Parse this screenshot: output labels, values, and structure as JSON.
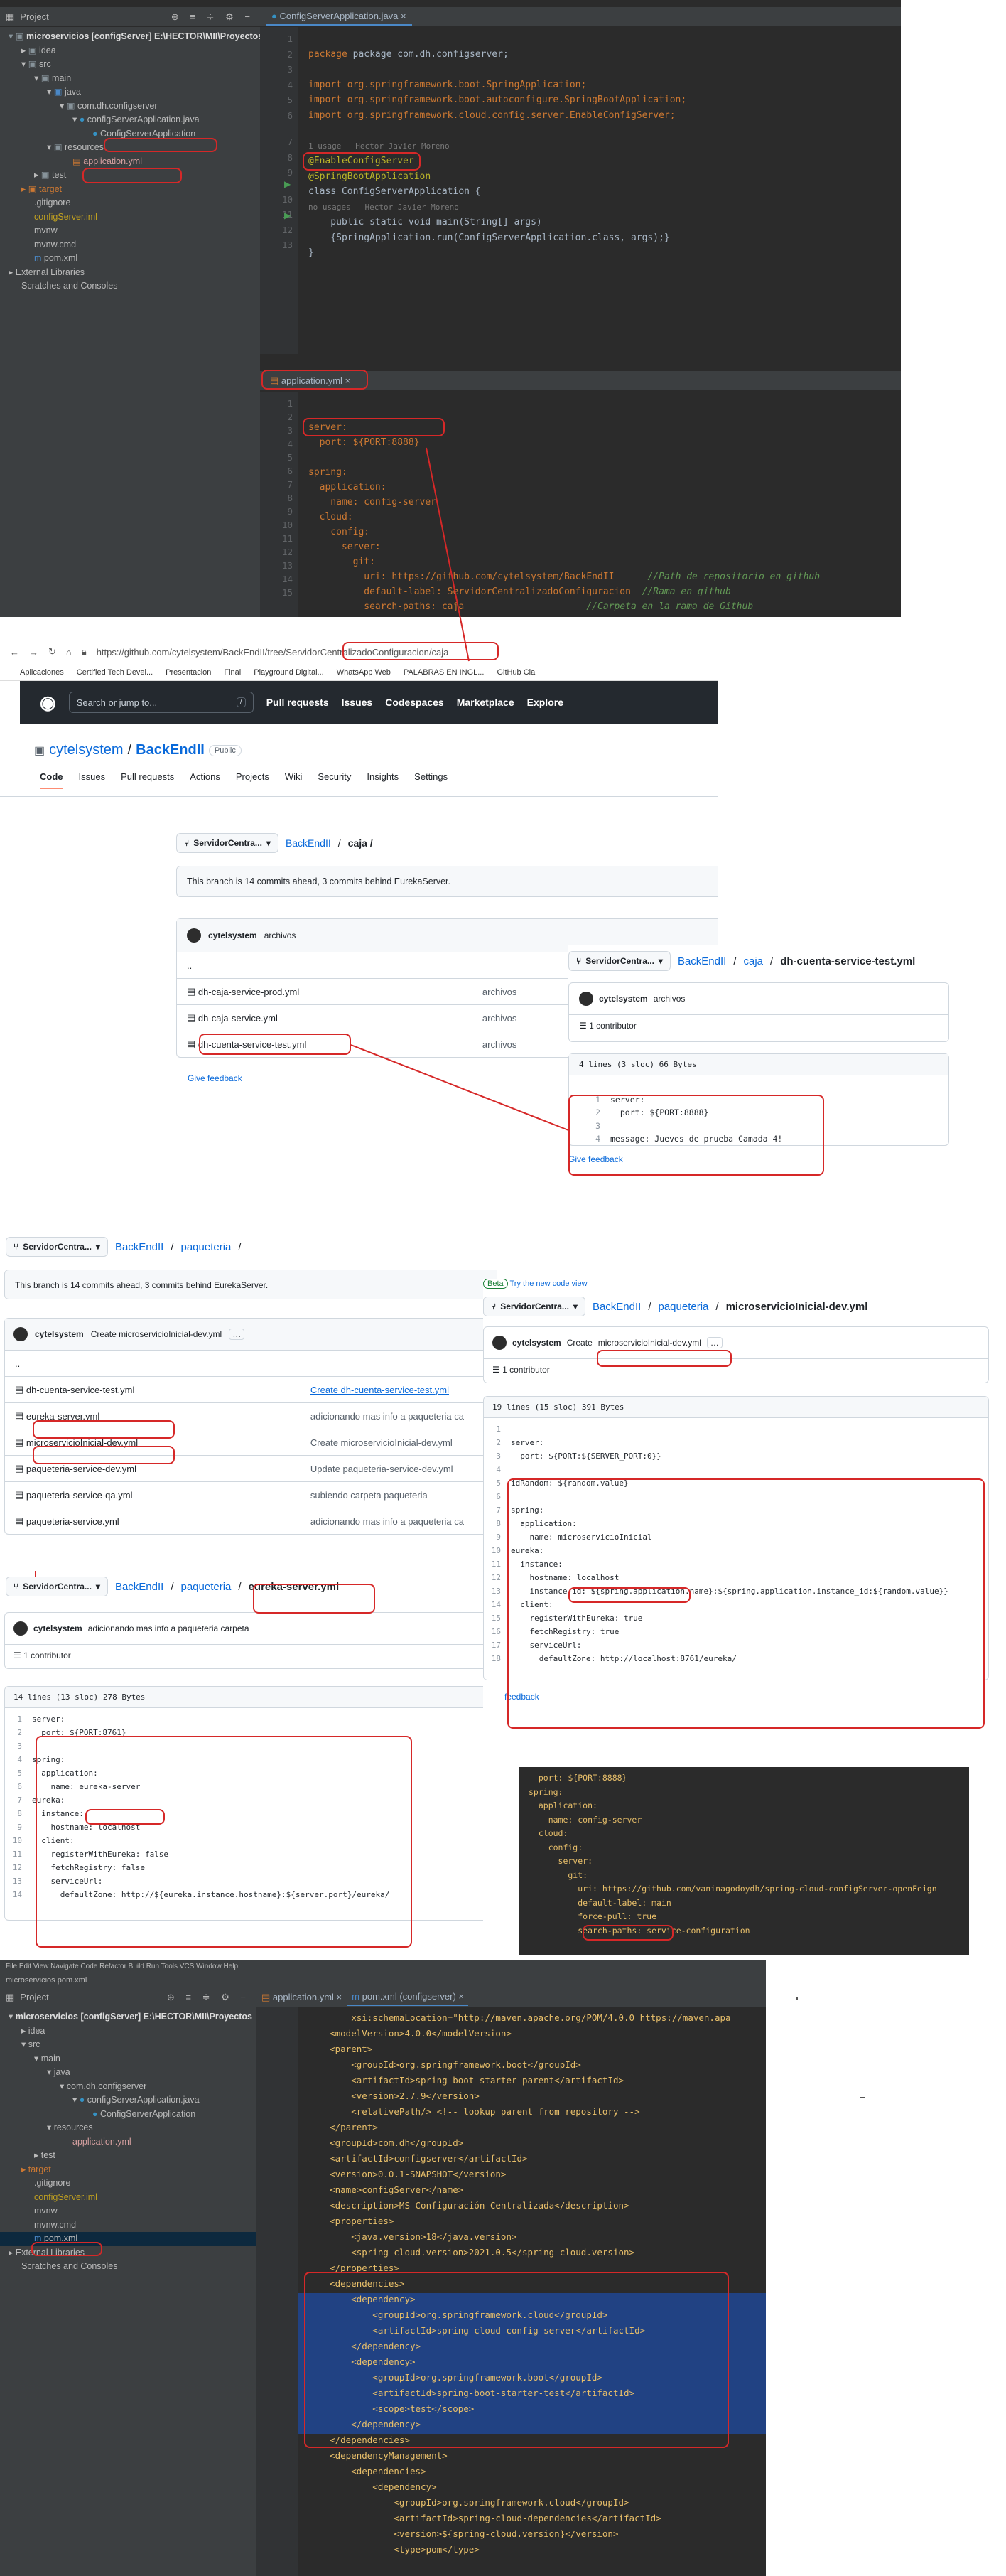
{
  "ide1": {
    "project_label": "Project",
    "tab": "ConfigServerApplication.java",
    "tree": [
      "microservicios [configServer] E:\\HECTOR\\MII\\Proyectos",
      "idea",
      "src",
      "main",
      "java",
      "com.dh.configserver",
      "configServerApplication.java",
      "ConfigServerApplication",
      "resources",
      "application.yml",
      "test",
      "target",
      ".gitignore",
      "configServer.iml",
      "mvnw",
      "mvnw.cmd",
      "pom.xml",
      "External Libraries",
      "Scratches and Consoles"
    ],
    "lines": [
      "1",
      "2",
      "3",
      "4",
      "5",
      "6",
      "7",
      "8",
      "9",
      "10",
      "11",
      "12",
      "13"
    ],
    "code": {
      "l1": "package com.dh.configserver;",
      "l3": "import org.springframework.boot.SpringApplication;",
      "l4": "import org.springframework.boot.autoconfigure.SpringBootApplication;",
      "l5": "import org.springframework.cloud.config.server.EnableConfigServer;",
      "hint1": "1 usage   Hector Javier Moreno",
      "l7": "@EnableConfigServer",
      "l8": "@SpringBootApplication",
      "l9": "class ConfigServerApplication {",
      "hint2": "no usages   Hector Javier Moreno",
      "l10": "    public static void main(String[] args)",
      "l11": "    {SpringApplication.run(ConfigServerApplication.class, args);}",
      "l12": "}"
    },
    "yml_tab": "application.yml",
    "yml_lines": [
      "1",
      "2",
      "3",
      "4",
      "5",
      "6",
      "7",
      "8",
      "9",
      "10",
      "11",
      "12",
      "13",
      "14",
      "15"
    ],
    "yml": {
      "server": "server:",
      "port": "  port: ${PORT:8888}",
      "spring": "spring:",
      "application": "  application:",
      "name": "    name: config-server",
      "cloud": "  cloud:",
      "config": "    config:",
      "srv": "      server:",
      "git": "        git:",
      "uri": "          uri: https://github.com/cytelsystem/BackEndII",
      "uri_c": "//Path de repositorio en github",
      "label": "          default-label: ServidorCentralizadoConfiguracion",
      "label_c": "//Rama en github",
      "search": "          search-paths: caja",
      "search_c": "//Carpeta en la rama de Github"
    }
  },
  "browser": {
    "url": "https://github.com/cytelsystem/BackEndII/tree/ServidorCentralizadoConfiguracion/caja",
    "bookmarks": [
      "Aplicaciones",
      "Certified Tech Devel...",
      "Presentacion",
      "Final",
      "Playground Digital...",
      "WhatsApp Web",
      "PALABRAS EN INGL...",
      "GitHub Cla"
    ]
  },
  "github": {
    "search": "Search or jump to...",
    "nav": [
      "Pull requests",
      "Issues",
      "Codespaces",
      "Marketplace",
      "Explore"
    ],
    "owner": "cytelsystem",
    "repo": "BackEndII",
    "visibility": "Public",
    "tabs": [
      "Code",
      "Issues",
      "Pull requests",
      "Actions",
      "Projects",
      "Wiki",
      "Security",
      "Insights",
      "Settings"
    ],
    "branch": "ServidorCentra...",
    "breadcrumb_caja": "caja /",
    "ahead_text": "This branch is 14 commits ahead, 3 commits behind EurekaServer.",
    "commit_user": "cytelsystem",
    "commit_msg": "archivos",
    "files": [
      {
        "name": "dh-caja-service-prod.yml",
        "msg": "archivos"
      },
      {
        "name": "dh-caja-service.yml",
        "msg": "archivos"
      },
      {
        "name": "dh-cuenta-service-test.yml",
        "msg": "archivos"
      }
    ],
    "up": "..",
    "feedback": "Give feedback",
    "cuenta_file": "dh-cuenta-service-test.yml",
    "contributor": "1 contributor",
    "cuenta_meta": "4 lines (3 sloc)   66 Bytes",
    "cuenta_code": [
      "server:",
      "  port: ${PORT:8888}",
      "",
      "message: Jueves de prueba Camada 4!"
    ],
    "paq": "paqueteria",
    "paq_msg": "Create microservicioInicial-dev.yml",
    "paq_files": [
      {
        "name": "dh-cuenta-service-test.yml",
        "msg": "Create dh-cuenta-service-test.yml"
      },
      {
        "name": "eureka-server.yml",
        "msg": "adicionando mas info a paqueteria ca"
      },
      {
        "name": "microservicioInicial-dev.yml",
        "msg": "Create microservicioInicial-dev.yml"
      },
      {
        "name": "paqueteria-service-dev.yml",
        "msg": "Update paqueteria-service-dev.yml"
      },
      {
        "name": "paqueteria-service-qa.yml",
        "msg": "subiendo carpeta paqueteria"
      },
      {
        "name": "paqueteria-service.yml",
        "msg": "adicionando mas info a paqueteria ca"
      }
    ],
    "beta": "Beta",
    "beta_text": "Try the new code view",
    "micro_file": "microservicioInicial-dev.yml",
    "micro_create": "Create",
    "micro_meta": "19 lines (15 sloc)   391 Bytes",
    "micro_code": [
      "",
      "server:",
      "  port: ${PORT:${SERVER_PORT:0}}",
      "",
      "idRandom: ${random.value}",
      "",
      "spring:",
      "  application:",
      "    name: microservicioInicial",
      "eureka:",
      "  instance:",
      "    hostname: localhost",
      "    instance-id: ${spring.application.name}:${spring.application.instance_id:${random.value}}",
      "  client:",
      "    registerWithEureka: true",
      "    fetchRegistry: true",
      "    serviceUrl:",
      "      defaultZone: http://localhost:8761/eureka/"
    ],
    "eureka_file": "eureka-server.yml",
    "eureka_msg": "adicionando mas info a paqueteria carpeta",
    "eureka_meta": "14 lines (13 sloc)   278 Bytes",
    "eureka_code": [
      "server:",
      "  port: ${PORT:8761}",
      "",
      "spring:",
      "  application:",
      "    name: eureka-server",
      "eureka:",
      "  instance:",
      "    hostname: localhost",
      "  client:",
      "    registerWithEureka: false",
      "    fetchRegistry: false",
      "    serviceUrl:",
      "      defaultZone: http://${eureka.instance.hostname}:${server.port}/eureka/"
    ],
    "feedback2": "feedback"
  },
  "snippet": [
    "  port: ${PORT:8888}",
    "",
    "spring:",
    "  application:",
    "    name: config-server",
    "  cloud:",
    "    config:",
    "      server:",
    "        git:",
    "          uri: https://github.com/vaninagodoydh/spring-cloud-configServer-openFeign",
    "          default-label: main",
    "          force-pull: true",
    "          search-paths: service-configuration"
  ],
  "ide2": {
    "menu": "File  Edit  View  Navigate  Code  Refactor  Build  Run  Tools  VCS  Window  Help",
    "breadcrumb": "microservicios  pom.xml",
    "tabs": [
      "application.yml",
      "pom.xml (configserver)"
    ],
    "tree": [
      "microservicios [configServer] E:\\HECTOR\\MII\\Proyectos",
      "idea",
      "src",
      "main",
      "java",
      "com.dh.configserver",
      "configServerApplication.java",
      "ConfigServerApplication",
      "resources",
      "application.yml",
      "test",
      "target",
      ".gitignore",
      "configServer.iml",
      "mvnw",
      "mvnw.cmd",
      "pom.xml",
      "External Libraries",
      "Scratches and Consoles"
    ],
    "code": [
      "        xsi:schemaLocation=\"http://maven.apache.org/POM/4.0.0 https://maven.apa",
      "    <modelVersion>4.0.0</modelVersion>",
      "    <parent>",
      "        <groupId>org.springframework.boot</groupId>",
      "        <artifactId>spring-boot-starter-parent</artifactId>",
      "        <version>2.7.9</version>",
      "        <relativePath/> <!-- lookup parent from repository -->",
      "    </parent>",
      "    <groupId>com.dh</groupId>",
      "    <artifactId>configserver</artifactId>",
      "    <version>0.0.1-SNAPSHOT</version>",
      "    <name>configServer</name>",
      "    <description>MS Configuración Centralizada</description>",
      "    <properties>",
      "        <java.version>18</java.version>",
      "        <spring-cloud.version>2021.0.5</spring-cloud.version>",
      "    </properties>",
      "    <dependencies>",
      "        <dependency>",
      "            <groupId>org.springframework.cloud</groupId>",
      "            <artifactId>spring-cloud-config-server</artifactId>",
      "        </dependency>",
      "",
      "        <dependency>",
      "            <groupId>org.springframework.boot</groupId>",
      "            <artifactId>spring-boot-starter-test</artifactId>",
      "            <scope>test</scope>",
      "        </dependency>",
      "    </dependencies>",
      "    <dependencyManagement>",
      "        <dependencies>",
      "            <dependency>",
      "                <groupId>org.springframework.cloud</groupId>",
      "                <artifactId>spring-cloud-dependencies</artifactId>",
      "                <version>${spring-cloud.version}</version>",
      "                <type>pom</type>"
    ],
    "lines": [
      "",
      "",
      "",
      "",
      "",
      "",
      "",
      "",
      "",
      "",
      "",
      "",
      "",
      "",
      "",
      "",
      "",
      "",
      "",
      "",
      "",
      "",
      "",
      "",
      "",
      "",
      "",
      "30",
      "",
      "",
      "",
      "",
      "",
      "",
      ""
    ]
  },
  "colors": {
    "ide_bg": "#2b2b2b",
    "panel": "#3c3f41",
    "annotation_red": "#d62828",
    "gh_header": "#24292f",
    "link": "#0969da",
    "selection": "#214283"
  }
}
